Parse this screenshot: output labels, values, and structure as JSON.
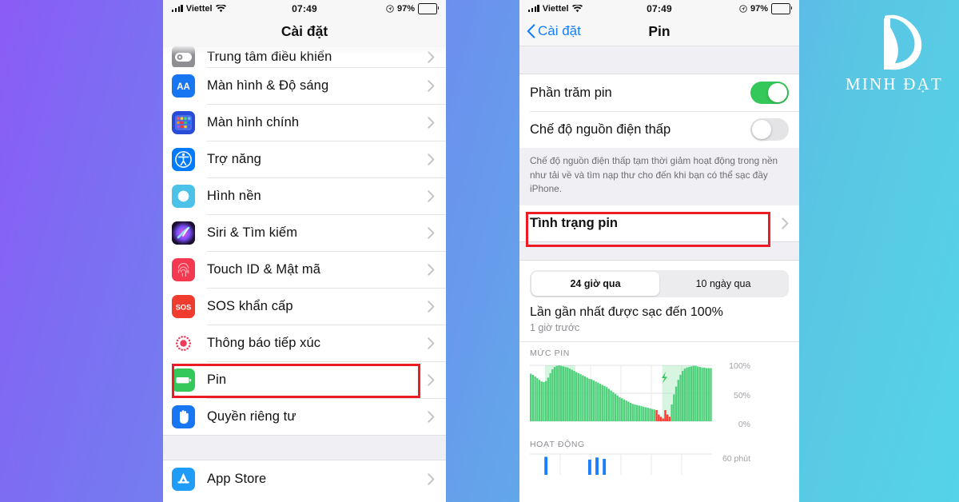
{
  "background": {
    "from": "#8b5cf6",
    "to": "#55d4e6"
  },
  "brand": {
    "name": "MINH ĐẠT",
    "mark": "letter-d-logo"
  },
  "phone_left": {
    "status_bar": {
      "carrier": "Viettel",
      "signal_icon": "signal-bars-icon",
      "wifi_icon": "wifi-icon",
      "time": "07:49",
      "location_icon": "location-arrow-icon",
      "battery_percent": "97%",
      "battery_icon": "battery-icon"
    },
    "nav": {
      "title": "Cài đặt"
    },
    "list": [
      {
        "label": "Trung tâm điều khiển",
        "icon": "control-center-icon",
        "icon_bg": "#8e8e93",
        "cut": true
      },
      {
        "label": "Màn hình & Độ sáng",
        "icon": "display-brightness-icon",
        "icon_bg": "#1876f2"
      },
      {
        "label": "Màn hình chính",
        "icon": "home-screen-icon",
        "icon_bg": "#2a4bd7"
      },
      {
        "label": "Trợ năng",
        "icon": "accessibility-icon",
        "icon_bg": "#007aff"
      },
      {
        "label": "Hình nền",
        "icon": "wallpaper-icon",
        "icon_bg": "#4cc2e8"
      },
      {
        "label": "Siri & Tìm kiếm",
        "icon": "siri-icon",
        "icon_bg": "#2b1b3d"
      },
      {
        "label": "Touch ID & Mật mã",
        "icon": "touch-id-icon",
        "icon_bg": "#f4384f"
      },
      {
        "label": "SOS khẩn cấp",
        "icon": "sos-icon",
        "icon_bg": "#f03b2f"
      },
      {
        "label": "Thông báo tiếp xúc",
        "icon": "exposure-notification-icon",
        "icon_bg": "#ffffff"
      },
      {
        "label": "Pin",
        "icon": "battery-settings-icon",
        "icon_bg": "#34c759",
        "highlighted": true
      },
      {
        "label": "Quyền riêng tư",
        "icon": "privacy-hand-icon",
        "icon_bg": "#1876f2"
      }
    ],
    "list2": [
      {
        "label": "App Store",
        "icon": "app-store-icon",
        "icon_bg": "#1f9cf7"
      }
    ],
    "chevron_icon": "chevron-right-icon"
  },
  "phone_right": {
    "status_bar": {
      "carrier": "Viettel",
      "signal_icon": "signal-bars-icon",
      "wifi_icon": "wifi-icon",
      "time": "07:49",
      "location_icon": "location-arrow-icon",
      "battery_percent": "97%",
      "battery_icon": "battery-icon"
    },
    "nav": {
      "back_label": "Cài đặt",
      "back_icon": "chevron-left-icon",
      "title": "Pin"
    },
    "toggles": [
      {
        "label": "Phần trăm pin",
        "state": "on"
      },
      {
        "label": "Chế độ nguồn điện thấp",
        "state": "off"
      }
    ],
    "footnote": "Chế độ nguồn điện thấp tạm thời giảm hoạt động trong nền như tải về và tìm nạp thư cho đến khi bạn có thể sạc đầy iPhone.",
    "battery_health_row": {
      "label": "Tình trạng pin",
      "highlighted": true,
      "chevron_icon": "chevron-right-icon"
    },
    "segmented": {
      "options": [
        "24 giờ qua",
        "10 ngày qua"
      ],
      "selected_index": 0
    },
    "last_charge": {
      "title": "Lần gần nhất được sạc đến 100%",
      "subtitle": "1 giờ trước"
    },
    "charts": {
      "battery_level": {
        "caption": "MỨC PIN",
        "y_labels": [
          "100%",
          "50%",
          "0%"
        ],
        "charging_icon": "lightning-bolt-icon"
      },
      "activity": {
        "caption": "HOẠT ĐỘNG",
        "y_label": "60 phút"
      }
    }
  },
  "chart_data": [
    {
      "type": "area",
      "title": "MỨC PIN",
      "xlabel": "",
      "ylabel": "",
      "ylim": [
        0,
        100
      ],
      "grid": true,
      "series": [
        {
          "name": "Mức pin (%)",
          "color": "#4fd07a",
          "values": [
            85,
            83,
            80,
            77,
            74,
            71,
            70,
            72,
            78,
            86,
            93,
            97,
            99,
            100,
            99,
            98,
            97,
            96,
            94,
            92,
            90,
            88,
            86,
            84,
            82,
            80,
            78,
            76,
            75,
            73,
            71,
            69,
            67,
            65,
            63,
            61,
            58,
            55,
            52,
            49,
            46,
            43,
            41,
            39,
            37,
            35,
            33,
            31,
            30,
            29,
            28,
            27,
            26,
            25,
            24,
            23,
            22,
            21,
            20,
            12,
            8,
            5,
            20,
            12,
            8,
            30,
            48,
            62,
            74,
            83,
            90,
            94,
            96,
            97,
            98,
            99,
            99,
            98,
            97,
            96,
            96,
            95,
            95,
            95
          ]
        }
      ],
      "charging_bands": [
        {
          "start_index": 7,
          "end_index": 20,
          "label": "sạc"
        },
        {
          "start_index": 61,
          "end_index": 76,
          "label": "sạc"
        }
      ],
      "low_battery_color": "#ff3b30",
      "legend": "none"
    },
    {
      "type": "bar",
      "title": "HOẠT ĐỘNG",
      "xlabel": "",
      "ylabel": "60 phút",
      "ylim": [
        0,
        60
      ],
      "grid": true,
      "color": "#1d7efd",
      "values": [
        0,
        0,
        0,
        0,
        52,
        0,
        0,
        0,
        0,
        0,
        0,
        0,
        0,
        0,
        0,
        0,
        44,
        0,
        50,
        0,
        46,
        0,
        0,
        0,
        0,
        0,
        0,
        0,
        0,
        0,
        0,
        0,
        0,
        0,
        0,
        0,
        0,
        0,
        0,
        0,
        0,
        0,
        0,
        0,
        0,
        0,
        0,
        0,
        0,
        0
      ]
    }
  ]
}
